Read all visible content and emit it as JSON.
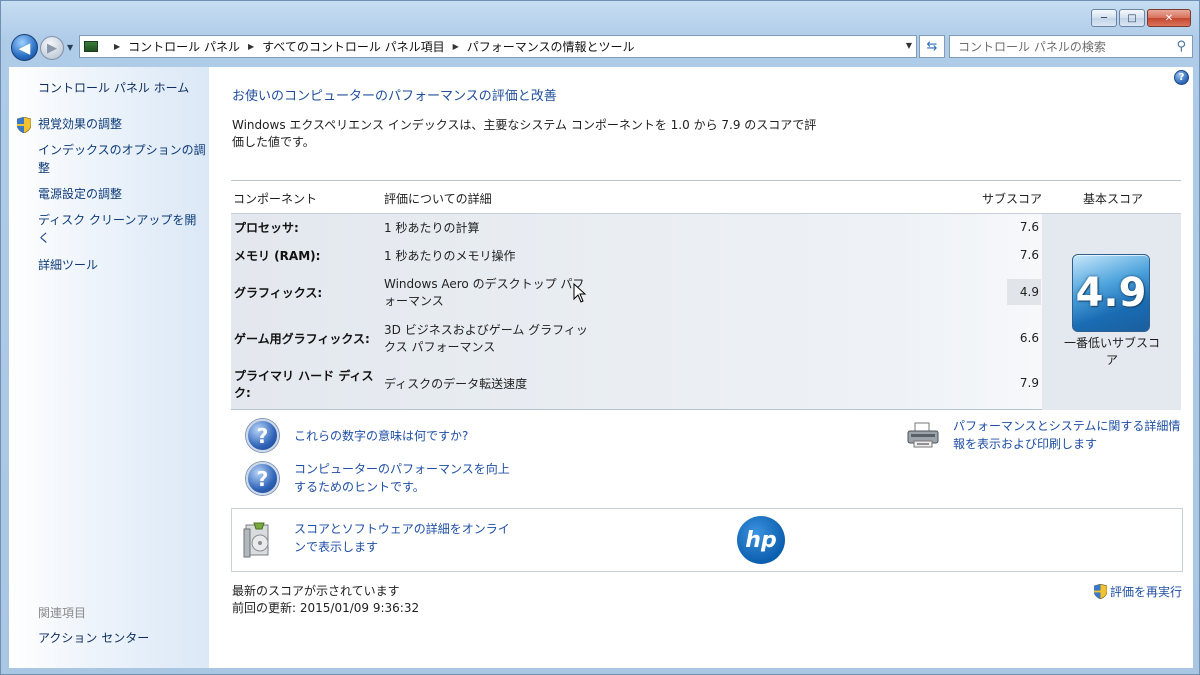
{
  "window": {
    "minimize": "─",
    "maximize": "□",
    "close": "✕"
  },
  "nav": {
    "back": "◀",
    "forward": "▶",
    "dropdown": "▼",
    "breadcrumb": [
      "コントロール パネル",
      "すべてのコントロール パネル項目",
      "パフォーマンスの情報とツール"
    ],
    "search_placeholder": "コントロール パネルの検索"
  },
  "sidebar": {
    "home": "コントロール パネル ホーム",
    "links": [
      "視覚効果の調整",
      "インデックスのオプションの調整",
      "電源設定の調整",
      "ディスク クリーンアップを開く",
      "詳細ツール"
    ],
    "related_heading": "関連項目",
    "related_links": [
      "アクション センター"
    ]
  },
  "main": {
    "heading": "お使いのコンピューターのパフォーマンスの評価と改善",
    "intro": "Windows エクスペリエンス インデックスは、主要なシステム コンポーネントを 1.0 から 7.9 のスコアで評価した値です。",
    "table": {
      "headers": {
        "component": "コンポーネント",
        "details": "評価についての詳細",
        "subscore": "サブスコア",
        "basescore": "基本スコア"
      },
      "rows": [
        {
          "component": "プロセッサ:",
          "details": "1 秒あたりの計算",
          "subscore": "7.6"
        },
        {
          "component": "メモリ (RAM):",
          "details": "1 秒あたりのメモリ操作",
          "subscore": "7.6"
        },
        {
          "component": "グラフィックス:",
          "details": "Windows Aero のデスクトップ パフォーマンス",
          "subscore": "4.9"
        },
        {
          "component": "ゲーム用グラフィックス:",
          "details": "3D ビジネスおよびゲーム グラフィックス パフォーマンス",
          "subscore": "6.6"
        },
        {
          "component": "プライマリ ハード ディスク:",
          "details": "ディスクのデータ転送速度",
          "subscore": "7.9"
        }
      ],
      "base_score": "4.9",
      "base_caption": "一番低いサブスコア"
    },
    "help_links": [
      "これらの数字の意味は何ですか?",
      "コンピューターのパフォーマンスを向上するためのヒントです。"
    ],
    "print_link": "パフォーマンスとシステムに関する詳細情報を表示および印刷します",
    "online_link": "スコアとソフトウェアの詳細をオンラインで表示します",
    "hp_logo": "hp",
    "status_text": "最新のスコアが示されています",
    "last_updated": "前回の更新: 2015/01/09 9:36:32",
    "rerun": "評価を再実行"
  },
  "colors": {
    "link": "#1f4fa5",
    "sidebar_link": "#0d3a78",
    "accent_blue": "#2b64b6"
  }
}
